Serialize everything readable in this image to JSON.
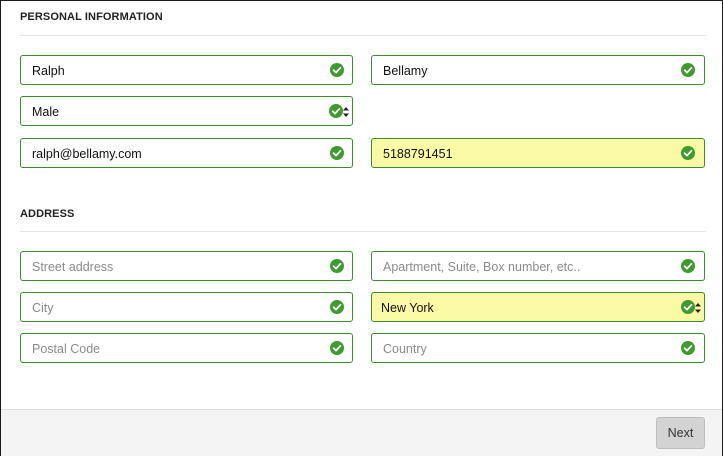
{
  "sections": {
    "personal": {
      "title": "PERSONAL INFORMATION"
    },
    "address": {
      "title": "ADDRESS"
    }
  },
  "personal": {
    "first_name": {
      "value": "Ralph",
      "status": "valid"
    },
    "last_name": {
      "value": "Bellamy",
      "status": "valid"
    },
    "gender": {
      "value": "Male",
      "status": "valid"
    },
    "email": {
      "value": "ralph@bellamy.com",
      "status": "valid"
    },
    "phone": {
      "value": "5188791451",
      "status": "valid",
      "highlighted": true
    }
  },
  "address": {
    "street": {
      "value": "",
      "placeholder": "Street address",
      "status": "valid"
    },
    "apartment": {
      "value": "",
      "placeholder": "Apartment, Suite, Box number, etc..",
      "status": "valid"
    },
    "city": {
      "value": "",
      "placeholder": "City",
      "status": "valid"
    },
    "state": {
      "value": "New York",
      "status": "valid",
      "highlighted": true
    },
    "postal_code": {
      "value": "",
      "placeholder": "Postal Code",
      "status": "valid"
    },
    "country": {
      "value": "",
      "placeholder": "Country",
      "status": "valid"
    }
  },
  "footer": {
    "next_label": "Next"
  },
  "icons": {
    "valid": "check-circle-icon",
    "select": "select-arrows-icon"
  },
  "colors": {
    "valid_border": "#3c8a2e",
    "valid_icon": "#3f9a2f",
    "highlight_bg": "#f9f9a6",
    "button_bg": "#d3d3d3"
  }
}
